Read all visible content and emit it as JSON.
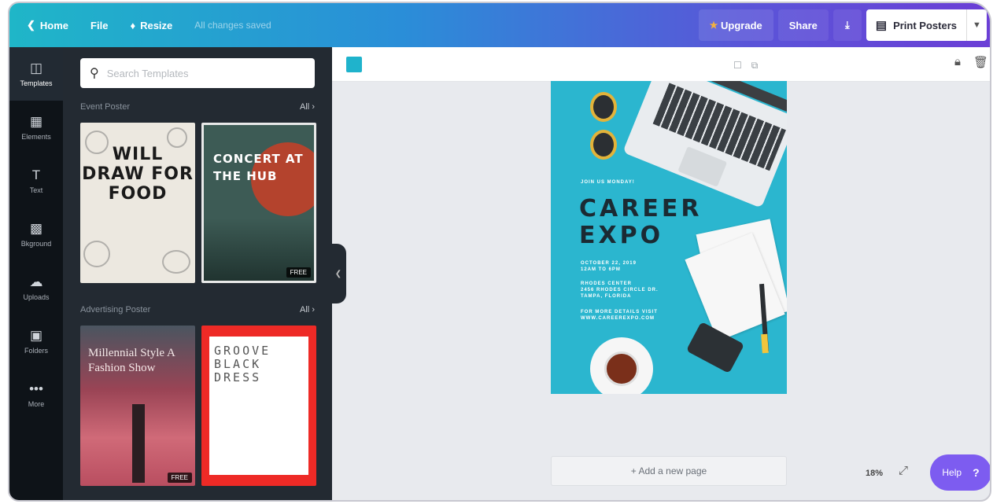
{
  "topbar": {
    "home_label": "Home",
    "file_label": "File",
    "resize_label": "Resize",
    "status": "All changes saved",
    "upgrade_label": "Upgrade",
    "share_label": "Share",
    "print_label": "Print Posters"
  },
  "rail": {
    "items": [
      {
        "label": "Templates",
        "icon": "templates-icon"
      },
      {
        "label": "Elements",
        "icon": "elements-icon"
      },
      {
        "label": "Text",
        "icon": "text-icon"
      },
      {
        "label": "Bkground",
        "icon": "background-icon"
      },
      {
        "label": "Uploads",
        "icon": "uploads-icon"
      },
      {
        "label": "Folders",
        "icon": "folder-icon"
      },
      {
        "label": "More",
        "icon": "more-icon"
      }
    ]
  },
  "panel": {
    "search_placeholder": "Search Templates",
    "section1": {
      "title": "Event Poster",
      "all": "All"
    },
    "section2": {
      "title": "Advertising Poster",
      "all": "All"
    },
    "thumbs": [
      {
        "title": "WILL DRAW FOR FOOD"
      },
      {
        "title": "CONCERT AT THE HUB",
        "badge": "FREE"
      },
      {
        "title": "Millennial Style A Fashion Show",
        "badge": "FREE"
      },
      {
        "title": "GROOVE BLACK DRESS"
      }
    ]
  },
  "poster": {
    "pre_title": "JOIN US MONDAY!",
    "title_line1": "CAREER",
    "title_line2": "EXPO",
    "date": "OCTOBER 22, 2019",
    "time": "12AM TO 6PM",
    "venue": "RHODES CENTER",
    "address": "2456 RHODES CIRCLE DR.",
    "city": "TAMPA, FLORIDA",
    "more_info": "FOR MORE DETAILS VISIT",
    "website": "WWW.CAREEREXPO.COM",
    "background_color": "#2bb6cf"
  },
  "canvas": {
    "add_page_label": "+ Add a new page",
    "zoom": "18%"
  },
  "help": {
    "label": "Help",
    "symbol": "?"
  },
  "colors": {
    "accent": "#7d5cf0",
    "swatch": "#1fb3cc"
  }
}
